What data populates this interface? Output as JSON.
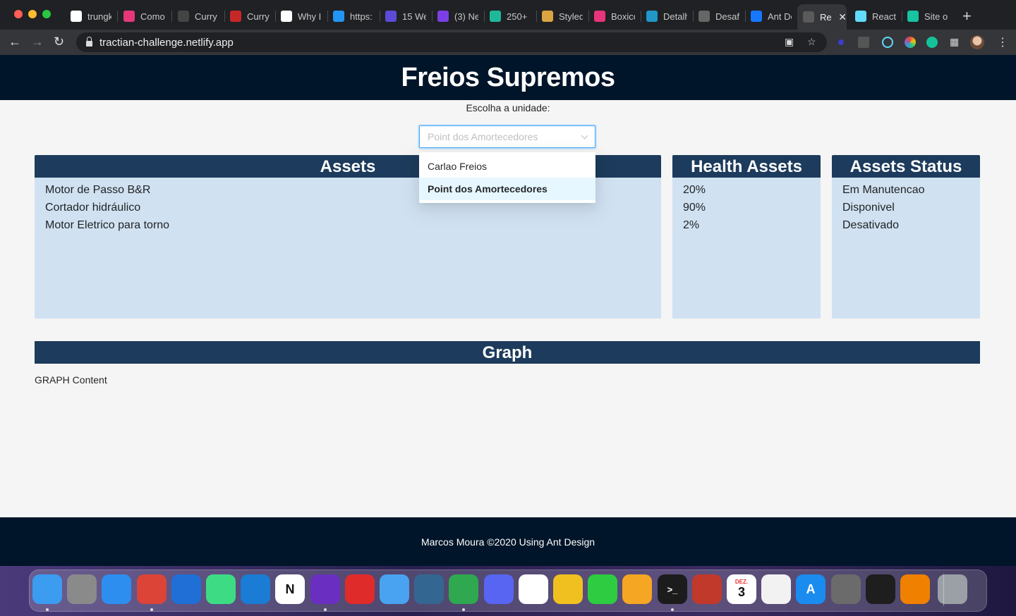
{
  "browser": {
    "tabs": [
      {
        "title": "trungk",
        "icon": "github-icon",
        "color": "#ffffff"
      },
      {
        "title": "Como",
        "icon": "c-logo-icon",
        "color": "#e4387a"
      },
      {
        "title": "Curry",
        "icon": "curry-icon",
        "color": "#444444"
      },
      {
        "title": "Curry",
        "icon": "curry-red-icon",
        "color": "#c62828"
      },
      {
        "title": "Why I",
        "icon": "medium-icon",
        "color": "#ffffff"
      },
      {
        "title": "https:",
        "icon": "w-icon",
        "color": "#2196f3"
      },
      {
        "title": "15 We",
        "icon": "a-icon",
        "color": "#5b4bd6"
      },
      {
        "title": "(3) Ne",
        "icon": "six-icon",
        "color": "#7b3fe4"
      },
      {
        "title": "250+",
        "icon": "d-icon",
        "color": "#1fb99a"
      },
      {
        "title": "Styled",
        "icon": "styled-icon",
        "color": "#d9a441"
      },
      {
        "title": "Boxicons",
        "icon": "box-icon",
        "color": "#e8347a"
      },
      {
        "title": "Detalh",
        "icon": "detail-icon",
        "color": "#2196c9"
      },
      {
        "title": "Desaf",
        "icon": "globe-icon",
        "color": "#666666"
      },
      {
        "title": "Ant De",
        "icon": "ant-icon",
        "color": "#1677ff"
      },
      {
        "title": "Re",
        "icon": "globe-icon",
        "color": "#5a5a5a"
      },
      {
        "title": "React",
        "icon": "react-icon",
        "color": "#61dafb"
      },
      {
        "title": "Site o",
        "icon": "diamond-icon",
        "color": "#17c3a1"
      }
    ],
    "url": "tractian-challenge.netlify.app"
  },
  "page": {
    "title": "Freios Supremos",
    "unit_label": "Escolha a unidade:",
    "select": {
      "value": "Point dos Amortecedores",
      "options": [
        "Carlao Freios",
        "Point dos Amortecedores"
      ],
      "selected_index": 1
    },
    "assets": {
      "title": "Assets",
      "items": [
        "Motor de Passo B&R",
        "Cortador hidráulico",
        "Motor Eletrico para torno"
      ]
    },
    "health": {
      "title": "Health Assets",
      "items": [
        "20%",
        "90%",
        "2%"
      ]
    },
    "status": {
      "title": "Assets Status",
      "items": [
        "Em Manutencao",
        "Disponivel",
        "Desativado"
      ]
    },
    "graph": {
      "title": "Graph",
      "content": "GRAPH Content"
    },
    "footer": "Marcos Moura ©2020 Using Ant Design"
  },
  "dock": {
    "apps": [
      {
        "name": "finder-icon",
        "color": "#3b9cf0",
        "glyph": ""
      },
      {
        "name": "launchpad-icon",
        "color": "#8a8a8a",
        "glyph": ""
      },
      {
        "name": "safari-icon",
        "color": "#2d8ef0",
        "glyph": ""
      },
      {
        "name": "chrome-icon",
        "color": "#db4437",
        "glyph": ""
      },
      {
        "name": "xcode-icon",
        "color": "#1f6fd6",
        "glyph": ""
      },
      {
        "name": "android-studio-icon",
        "color": "#3ddc84",
        "glyph": ""
      },
      {
        "name": "vscode-icon",
        "color": "#1a7cd4",
        "glyph": ""
      },
      {
        "name": "notion-icon",
        "color": "#ffffff",
        "glyph": "N"
      },
      {
        "name": "moon-app-icon",
        "color": "#6a2fc0",
        "glyph": ""
      },
      {
        "name": "flower-app-icon",
        "color": "#e02b2b",
        "glyph": ""
      },
      {
        "name": "tableplus-icon",
        "color": "#4aa3f0",
        "glyph": ""
      },
      {
        "name": "postgres-icon",
        "color": "#336791",
        "glyph": ""
      },
      {
        "name": "mongodb-icon",
        "color": "#2fa84f",
        "glyph": ""
      },
      {
        "name": "discord-icon",
        "color": "#5865f2",
        "glyph": ""
      },
      {
        "name": "slack-icon",
        "color": "#ffffff",
        "glyph": ""
      },
      {
        "name": "insomnia-icon",
        "color": "#f0c020",
        "glyph": ""
      },
      {
        "name": "facetime-icon",
        "color": "#2ecc40",
        "glyph": ""
      },
      {
        "name": "photos-icon",
        "color": "#f5a623",
        "glyph": ""
      },
      {
        "name": "terminal-icon",
        "color": "#1c1c1c",
        "glyph": ">_"
      },
      {
        "name": "popcorn-icon",
        "color": "#c0392b",
        "glyph": ""
      },
      {
        "name": "calendar-icon",
        "color": "#ffffff",
        "glyph": "3"
      },
      {
        "name": "textedit-icon",
        "color": "#f2f2f2",
        "glyph": ""
      },
      {
        "name": "app-store-icon",
        "color": "#1a8cf0",
        "glyph": "A"
      },
      {
        "name": "gimp-icon",
        "color": "#6b6b6b",
        "glyph": ""
      },
      {
        "name": "figma-icon",
        "color": "#1e1e1e",
        "glyph": ""
      },
      {
        "name": "vlc-icon",
        "color": "#f08000",
        "glyph": ""
      },
      {
        "name": "trash-icon",
        "color": "#9aa0a6",
        "glyph": ""
      }
    ],
    "calendar_month": "DEZ."
  },
  "colors": {
    "header_bg": "#001529",
    "card_head_bg": "#1d3b5c",
    "card_body_bg": "#d0e1f1",
    "select_border": "#40a9ff"
  }
}
